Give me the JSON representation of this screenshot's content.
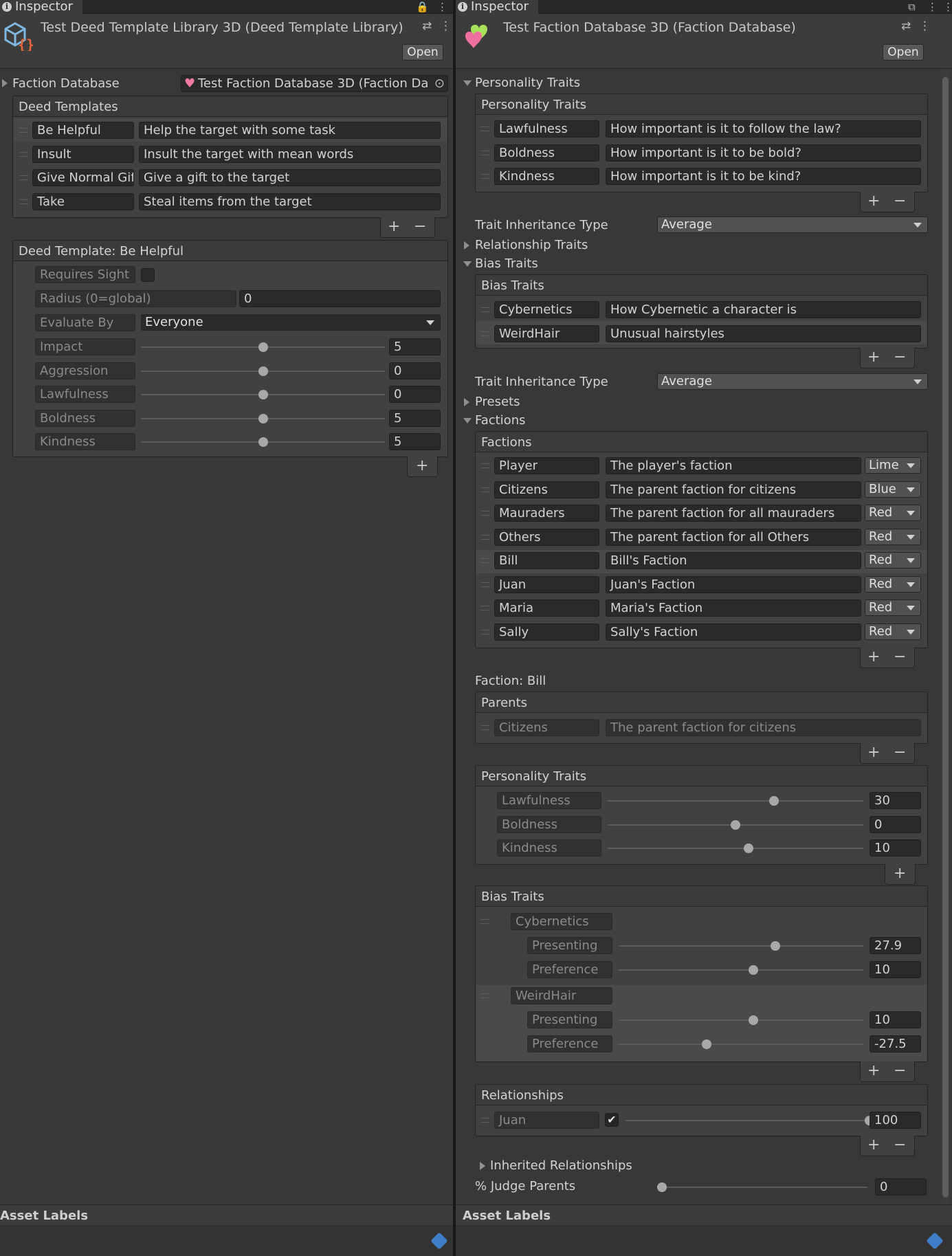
{
  "left": {
    "tab_label": "Inspector",
    "title": "Test Deed Template Library 3D (Deed Template Library)",
    "open_label": "Open",
    "faction_db_label": "Faction Database",
    "faction_db_value": "Test Faction Database 3D (Faction Da",
    "deed_templates_header": "Deed Templates",
    "deeds": [
      {
        "name": "Be Helpful",
        "desc": "Help the target with some task"
      },
      {
        "name": "Insult",
        "desc": "Insult the target with mean words"
      },
      {
        "name": "Give Normal Gif",
        "desc": "Give a gift to the target"
      },
      {
        "name": "Take",
        "desc": "Steal items from the target"
      }
    ],
    "deed_detail_header": "Deed Template: Be Helpful",
    "requires_sight_label": "Requires Sight",
    "radius_label": "Radius (0=global)",
    "radius_value": "0",
    "evaluate_by_label": "Evaluate By",
    "evaluate_by_value": "Everyone",
    "sliders": [
      {
        "label": "Impact",
        "value": "5",
        "fraction": 0.5
      },
      {
        "label": "Aggression",
        "value": "0",
        "fraction": 0.5
      },
      {
        "label": "Lawfulness",
        "value": "0",
        "fraction": 0.5
      },
      {
        "label": "Boldness",
        "value": "5",
        "fraction": 0.5
      },
      {
        "label": "Kindness",
        "value": "5",
        "fraction": 0.5
      }
    ],
    "asset_labels": "Asset Labels"
  },
  "right": {
    "tab_label": "Inspector",
    "title": "Test Faction Database 3D (Faction Database)",
    "open_label": "Open",
    "personality_traits_foldout": "Personality Traits",
    "personality_traits_header": "Personality Traits",
    "personality_traits": [
      {
        "name": "Lawfulness",
        "desc": "How important is it to follow the law?"
      },
      {
        "name": "Boldness",
        "desc": "How important is it to be bold?"
      },
      {
        "name": "Kindness",
        "desc": "How important is it to be kind?"
      }
    ],
    "trait_inheritance_label": "Trait Inheritance Type",
    "trait_inheritance_value": "Average",
    "relationship_traits_foldout": "Relationship Traits",
    "bias_traits_foldout": "Bias Traits",
    "bias_traits_header": "Bias Traits",
    "bias_traits": [
      {
        "name": "Cybernetics",
        "desc": "How Cybernetic a character is"
      },
      {
        "name": "WeirdHair",
        "desc": "Unusual hairstyles"
      }
    ],
    "trait_inheritance_label2": "Trait Inheritance Type",
    "trait_inheritance_value2": "Average",
    "presets_foldout": "Presets",
    "factions_foldout": "Factions",
    "factions_header": "Factions",
    "factions": [
      {
        "name": "Player",
        "desc": "The player's faction",
        "color": "Lime"
      },
      {
        "name": "Citizens",
        "desc": "The parent faction for citizens",
        "color": "Blue"
      },
      {
        "name": "Mauraders",
        "desc": "The parent faction for all mauraders",
        "color": "Red"
      },
      {
        "name": "Others",
        "desc": "The parent faction for all Others",
        "color": "Red"
      },
      {
        "name": "Bill",
        "desc": "Bill's Faction",
        "color": "Red"
      },
      {
        "name": "Juan",
        "desc": "Juan's Faction",
        "color": "Red"
      },
      {
        "name": "Maria",
        "desc": "Maria's Faction",
        "color": "Red"
      },
      {
        "name": "Sally",
        "desc": "Sally's Faction",
        "color": "Red"
      }
    ],
    "faction_label": "Faction: Bill",
    "parents_header": "Parents",
    "parent_name": "Citizens",
    "parent_desc": "The parent faction for citizens",
    "faction_personality_header": "Personality Traits",
    "faction_personality": [
      {
        "label": "Lawfulness",
        "value": "30",
        "fraction": 0.65
      },
      {
        "label": "Boldness",
        "value": "0",
        "fraction": 0.5
      },
      {
        "label": "Kindness",
        "value": "10",
        "fraction": 0.55
      }
    ],
    "faction_bias_header": "Bias Traits",
    "faction_bias": [
      {
        "name": "Cybernetics",
        "presenting_label": "Presenting",
        "presenting": "27.9",
        "presenting_fraction": 0.64,
        "preference_label": "Preference",
        "preference": "10",
        "preference_fraction": 0.55
      },
      {
        "name": "WeirdHair",
        "presenting_label": "Presenting",
        "presenting": "10",
        "presenting_fraction": 0.55,
        "preference_label": "Preference",
        "preference": "-27.5",
        "preference_fraction": 0.36
      }
    ],
    "relationships_header": "Relationships",
    "relationship": {
      "name": "Juan",
      "value": "100",
      "fraction": 1.0
    },
    "inherited_relationships": "Inherited Relationships",
    "judge_parents_label": "% Judge Parents",
    "judge_parents_value": "0",
    "judge_parents_fraction": 0.0,
    "asset_labels": "Asset Labels"
  }
}
